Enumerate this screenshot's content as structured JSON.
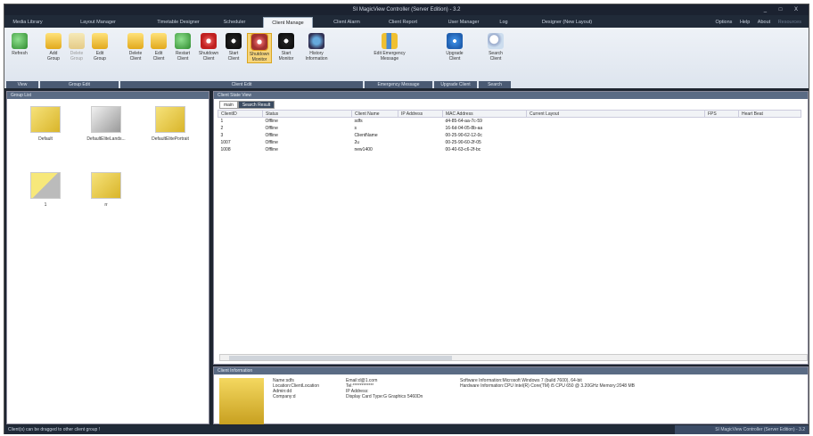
{
  "window": {
    "title": "SI MagicView Controller (Server Edition) - 3.2",
    "controls": "_ □ X"
  },
  "tabs": [
    "Media Library",
    "Layout Manager",
    "Timetable Designer",
    "Scheduler",
    "Client Manage",
    "Client Alarm",
    "Client Report",
    "User Manager",
    "Log",
    "Designer (New Layout)"
  ],
  "active_tab": "Client Manage",
  "right_menu": [
    "Options",
    "Help",
    "About",
    "Resources"
  ],
  "ribbon": {
    "buttons": [
      {
        "label": "Refresh",
        "icon": "refresh-icon"
      },
      {
        "label": "Add Group",
        "icon": "add-group-icon"
      },
      {
        "label": "Delete Group",
        "icon": "delete-group-icon"
      },
      {
        "label": "Edit Group",
        "icon": "edit-group-icon"
      },
      {
        "label": "Delete Client",
        "icon": "delete-client-icon"
      },
      {
        "label": "Edit Client",
        "icon": "edit-client-icon"
      },
      {
        "label": "Restart Client",
        "icon": "restart-client-icon"
      },
      {
        "label": "Shutdown Client",
        "icon": "shutdown-client-icon"
      },
      {
        "label": "Start Client",
        "icon": "start-client-icon"
      },
      {
        "label": "Shutdown Monitor",
        "icon": "shutdown-monitor-icon"
      },
      {
        "label": "Start Monitor",
        "icon": "start-monitor-icon"
      },
      {
        "label": "History Information",
        "icon": "history-icon"
      },
      {
        "label": "Edit Emergency Message",
        "icon": "emergency-message-icon"
      },
      {
        "label": "Upgrade Client",
        "icon": "upgrade-client-icon"
      },
      {
        "label": "Search Client",
        "icon": "search-client-icon"
      }
    ],
    "groups": [
      "View",
      "Group Edit",
      "Client Edit",
      "Emergency Message",
      "Upgrade Client",
      "Search"
    ]
  },
  "left_panel": {
    "title": "Group List",
    "groups": [
      "Default",
      "DefaultEliteLands...",
      "DefaultElitePortrait",
      "1",
      "rr"
    ]
  },
  "client_view": {
    "title": "Client State View",
    "tabs": [
      "main",
      "Search Result"
    ],
    "columns": [
      "ClientID",
      "Status",
      "Client Name",
      "IP Address",
      "MAC Address",
      "Current Layout",
      "FPS",
      "Heart Beat"
    ],
    "rows": [
      [
        "1",
        "Offline",
        "sdfs",
        "",
        "d4-85-64-aa-7c-59",
        "",
        "",
        ""
      ],
      [
        "2",
        "Offline",
        "s",
        "",
        "16-6d-04-05-8b-aa",
        "",
        "",
        ""
      ],
      [
        "3",
        "Offline",
        "ClientName",
        "",
        "00-25-90-62-12-0c",
        "",
        "",
        ""
      ],
      [
        "1007",
        "Offline",
        "2u",
        "",
        "00-25-90-60-2f-05",
        "",
        "",
        ""
      ],
      [
        "1008",
        "Offline",
        "new1400",
        "",
        "00-40-63-c6-2f-bc",
        "",
        "",
        ""
      ]
    ]
  },
  "client_info": {
    "title": "Client Information",
    "col1": [
      "Name:sdfs",
      "Location:ClientLocation",
      "Admin:dd",
      "Company:d"
    ],
    "col2": [
      "Email:d@1.com",
      "Tel:************",
      "IP Address:",
      "Display Card Type:G Graphics 5460Dn"
    ],
    "col3": [
      "Software Information:Microsoft Windows 7 (build 7600), 64-bit",
      "Hardware Information:CPU Intel(R) Core(TM) i5 CPU   650 @ 3.20GHz Memory:2048 MB"
    ]
  },
  "status": {
    "left": "Client(s) can be dragged to other client group !",
    "right": "SI MagicView Controller (Server Edition) - 3.2"
  }
}
